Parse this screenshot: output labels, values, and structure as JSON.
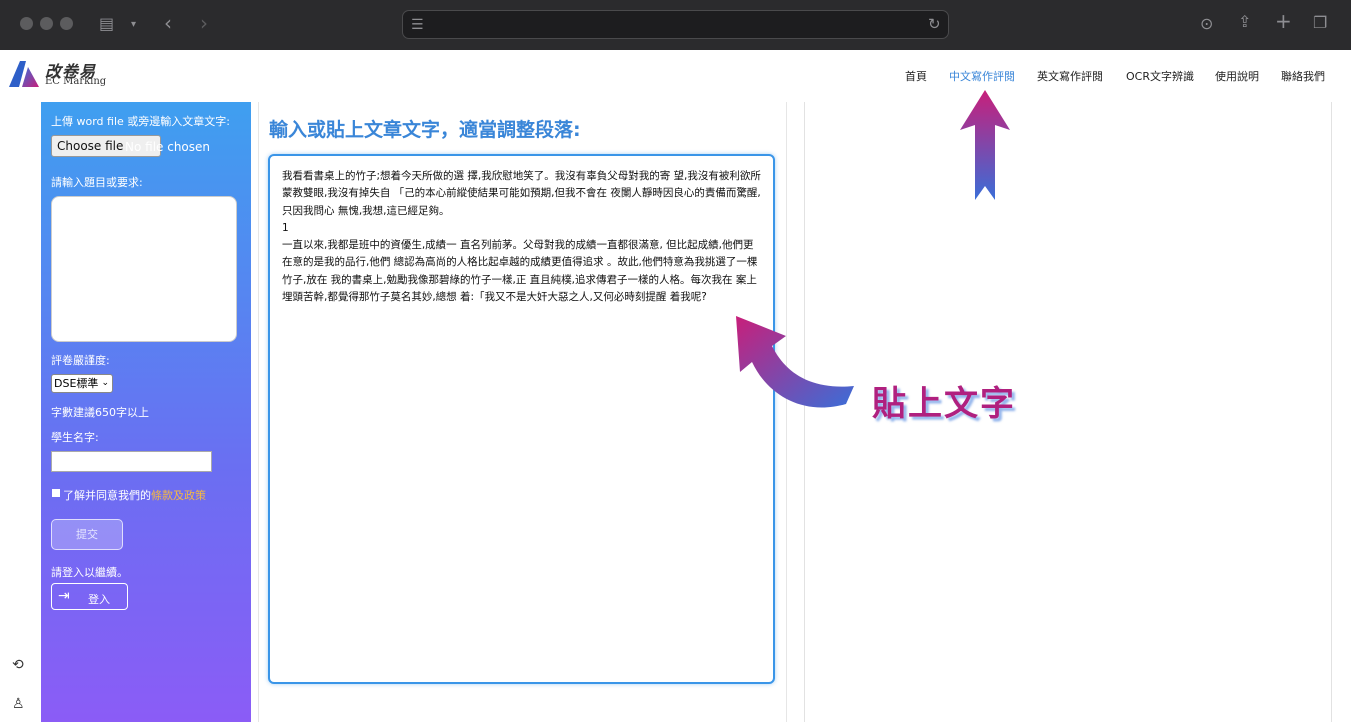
{
  "site": {
    "logo_cn": "改卷易",
    "logo_en": "EC Marking",
    "nav": [
      "首頁",
      "中文寫作評閱",
      "英文寫作評閱",
      "OCR文字辨識",
      "使用說明",
      "聯絡我們"
    ],
    "active_nav": "中文寫作評閱"
  },
  "sidebar": {
    "upload_label": "上傳 word file 或旁邊輸入文章文字:",
    "choose_file": "Choose file",
    "no_file": "No file chosen",
    "topic_label": "請輸入題目或要求:",
    "topic_value": "",
    "strictness_label": "評卷嚴謹度:",
    "strictness_value": "DSE標準",
    "word_hint": "字數建議650字以上",
    "student_label": "學生名字:",
    "student_value": "",
    "agree_text": "了解并同意我們的",
    "terms_link": "條款及政策",
    "submit": "提交",
    "login_hint": "請登入以繼續。",
    "login": "登入"
  },
  "icons": {
    "rail": [
      "history-icon",
      "user-icon"
    ],
    "login": "sign-in-icon"
  },
  "main": {
    "heading": "輸入或貼上文章文字，適當調整段落:",
    "essay": "我看看書桌上的竹子;想着今天所做的選 擇,我欣慰地笑了。我沒有辜負父母對我的寄 望,我沒有被利欲所蒙教雙眼,我沒有掉失自 「己的本心前縱使結果可能如預期,但我不會在 夜闌人靜時因良心的責備而驚醒,只因我問心 無愧,我想,這已經足夠。\n1\n一直以來,我都是班中的資優生,成績一 直名列前茅。父母對我的成績一直都很滿意, 但比起成績,他們更在意的是我的品行,他們 總認為高尚的人格比起卓越的成績更值得追求 。故此,他們特意為我挑選了一棵竹子,放在 我的書桌上,勉勵我像那碧綠的竹子一樣,正 直且純樸,追求傳君子一樣的人格。每次我在 案上埋頭苦幹,都覺得那竹子莫名其妙,總想 着:「我又不是大奸大惡之人,又何必時刻提醒 着我呢?",
    "callout": "貼上文字"
  },
  "colors": {
    "accent": "#3a86d8",
    "callout": "#b0207f",
    "sidebar_top": "#3f9ff0",
    "sidebar_bottom": "#8b5cf6",
    "terms": "#f5b942"
  }
}
